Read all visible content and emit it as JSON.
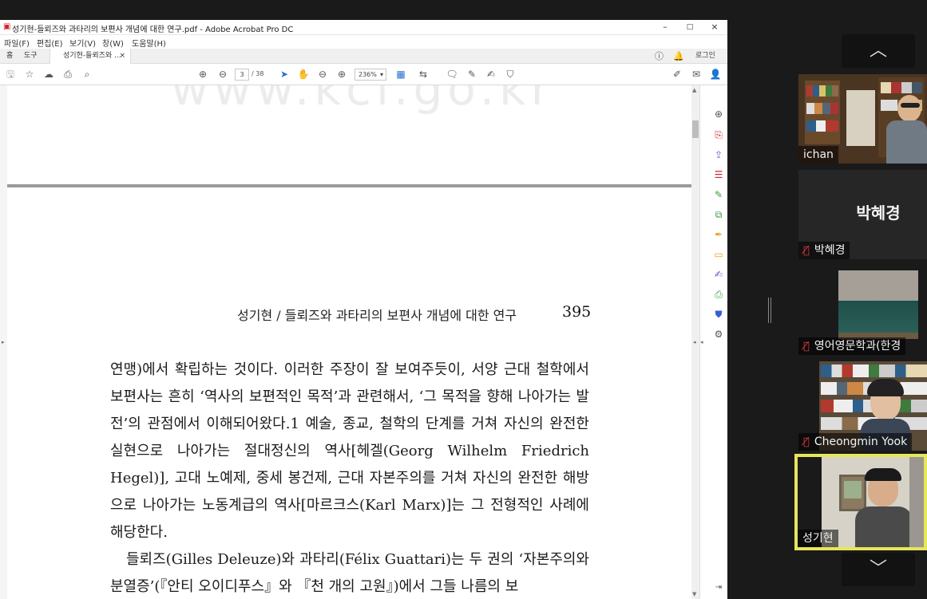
{
  "acrobat": {
    "title": "성기현-들뢰즈와 과타리의 보편사 개념에 대한 연구.pdf - Adobe Acrobat Pro DC",
    "window_buttons": {
      "minimize": "–",
      "maximize": "□",
      "close": "×"
    },
    "menu": [
      "파일(F)",
      "편집(E)",
      "보기(V)",
      "창(W)",
      "도움말(H)"
    ],
    "tabs": {
      "home": "홈",
      "tools": "도구",
      "doc": "성기현-들뢰즈와 ...",
      "doc_close": "×"
    },
    "signin": "로그인",
    "toolbar": {
      "page_current": "3",
      "page_total": "/ 38",
      "zoom": "236%"
    }
  },
  "document": {
    "watermark": "www.kci.go.kr",
    "running_head": "성기현 / 들뢰즈와 과타리의 보편사 개념에 대한 연구",
    "page_number": "395",
    "paragraphs": [
      "연맹)에서 확립하는 것이다. 이러한 주장이 잘 보여주듯이, 서양 근대 철학에서 보편사는 흔히 ‘역사의 보편적인 목적’과 관련해서, ‘그 목적을 향해 나아가는 발전’의 관점에서 이해되어왔다.1 예술, 종교, 철학의 단계를 거쳐 자신의 완전한 실현으로 나아가는 절대정신의 역사[헤겔(Georg Wilhelm Friedrich Hegel)], 고대 노예제, 중세 봉건제, 근대 자본주의를 거쳐 자신의 완전한 해방으로 나아가는 노동계급의 역사[마르크스(Karl Marx)]는 그 전형적인 사례에 해당한다.",
      "들뢰즈(Gilles Deleuze)와 과타리(Félix Guattari)는 두 권의 ‘자본주의와 분열증’(『안티 오이디푸스』와 『천 개의 고원』)에서 그들 나름의 보"
    ]
  },
  "zoom": {
    "nav_up": "︿",
    "nav_down": "﹀",
    "participants": [
      {
        "name": "ichan",
        "muted": false
      },
      {
        "name": "박혜경",
        "muted": true,
        "video": false,
        "display": "박혜경"
      },
      {
        "name": "영어영문학과(한경",
        "muted": true
      },
      {
        "name": "Cheongmin Yook",
        "muted": true
      },
      {
        "name": "성기현",
        "muted": false,
        "active_speaker": true
      }
    ],
    "mute_icon": "🎙",
    "colors": {
      "active_border": "#e6e65a",
      "mute": "#e0393e"
    }
  }
}
